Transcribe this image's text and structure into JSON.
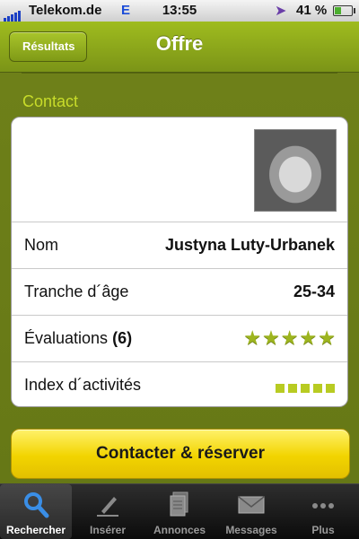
{
  "status_bar": {
    "carrier": "Telekom.de",
    "network": "E",
    "time": "13:55",
    "battery_text": "41 %",
    "battery_level": 0.41
  },
  "nav": {
    "back_label": "Résultats",
    "title": "Offre"
  },
  "section": {
    "title": "Contact"
  },
  "contact": {
    "name_label": "Nom",
    "name_value": "Justyna Luty-Urbanek",
    "age_label": "Tranche d´âge",
    "age_value": "25-34",
    "ratings_label": "Évaluations",
    "ratings_count": "(6)",
    "ratings_stars": 5,
    "activity_label": "Index d´activités",
    "activity_level": 5
  },
  "cta_label": "Contacter & réserver",
  "tabs": [
    {
      "label": "Rechercher",
      "icon": "search-icon",
      "active": true
    },
    {
      "label": "Insérer",
      "icon": "pencil-icon",
      "active": false
    },
    {
      "label": "Annonces",
      "icon": "documents-icon",
      "active": false
    },
    {
      "label": "Messages",
      "icon": "envelope-icon",
      "active": false
    },
    {
      "label": "Plus",
      "icon": "more-icon",
      "active": false
    }
  ],
  "colors": {
    "nav_green": "#8aa41b",
    "accent_yellow": "#f2d400",
    "section_title": "#c8dc2a"
  }
}
